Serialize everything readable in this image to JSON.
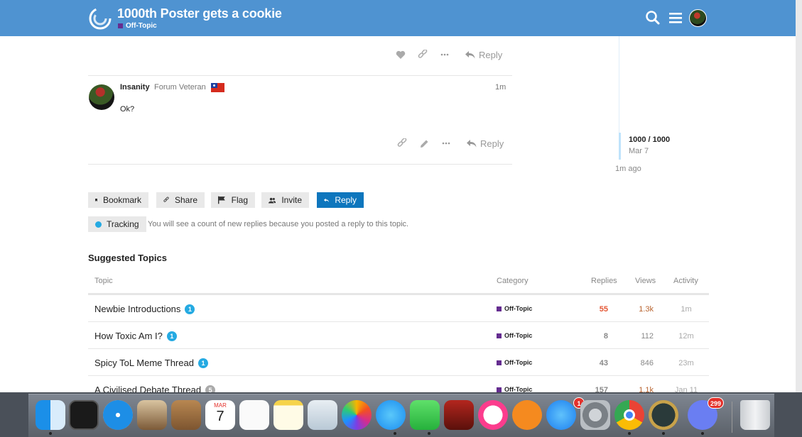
{
  "header": {
    "title": "1000th Poster gets a cookie",
    "category": "Off-Topic",
    "category_color": "#652d90",
    "brand_color": "#4f93d1"
  },
  "post_actions_top": {
    "reply_label": "Reply"
  },
  "post": {
    "username": "Insanity",
    "user_title": "Forum Veteran",
    "time": "1m",
    "body": "Ok?",
    "reply_label": "Reply"
  },
  "timeline": {
    "count": "1000 / 1000",
    "date": "Mar 7",
    "ago": "1m ago"
  },
  "footer_buttons": {
    "bookmark": "Bookmark",
    "share": "Share",
    "flag": "Flag",
    "invite": "Invite",
    "reply": "Reply"
  },
  "tracking": {
    "label": "Tracking",
    "description": "You will see a count of new replies because you posted a reply to this topic."
  },
  "suggested": {
    "heading": "Suggested Topics",
    "columns": {
      "topic": "Topic",
      "category": "Category",
      "replies": "Replies",
      "views": "Views",
      "activity": "Activity"
    },
    "rows": [
      {
        "title": "Newbie Introductions",
        "badge": "1",
        "category": "Off-Topic",
        "replies": "55",
        "views": "1.3k",
        "activity": "1m"
      },
      {
        "title": "How Toxic Am I?",
        "badge": "1",
        "category": "Off-Topic",
        "replies": "8",
        "views": "112",
        "activity": "12m"
      },
      {
        "title": "Spicy ToL Meme Thread",
        "badge": "1",
        "category": "Off-Topic",
        "replies": "43",
        "views": "846",
        "activity": "23m"
      },
      {
        "title": "A Civilised Debate Thread",
        "badge": "5",
        "category": "Off-Topic",
        "replies": "157",
        "views": "1.1k",
        "activity": "Jan 11"
      }
    ]
  },
  "dock": {
    "calendar_month": "MAR",
    "calendar_day": "7",
    "app_store_badge": "1",
    "discord_badge": "299",
    "apps": [
      "finder-icon",
      "dashboard-icon",
      "safari-icon",
      "mail-icon",
      "contacts-icon",
      "calendar-icon",
      "reminders-icon",
      "notes-icon",
      "preview-icon",
      "photos-icon",
      "messages-icon",
      "facetime-icon",
      "photo-booth-icon",
      "itunes-icon",
      "ibooks-icon",
      "app-store-icon",
      "system-preferences-icon",
      "chrome-icon",
      "league-of-legends-icon",
      "discord-icon",
      "trash-icon"
    ]
  }
}
